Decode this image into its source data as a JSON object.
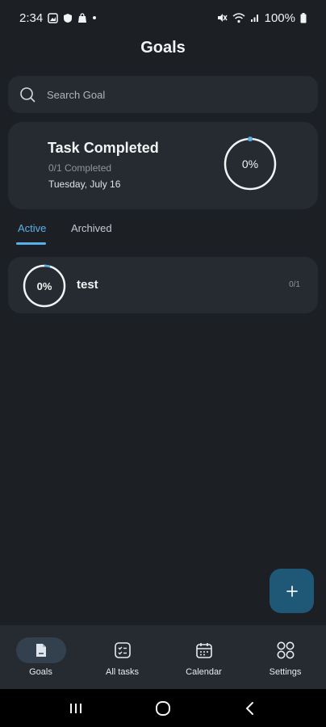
{
  "status_bar": {
    "time": "2:34",
    "battery": "100%"
  },
  "header": {
    "title": "Goals"
  },
  "search": {
    "placeholder": "Search Goal"
  },
  "summary": {
    "title": "Task Completed",
    "count": "0/1 Completed",
    "date": "Tuesday, July 16",
    "percent_label": "0%",
    "progress": 0
  },
  "tabs": [
    {
      "label": "Active",
      "selected": true
    },
    {
      "label": "Archived",
      "selected": false
    }
  ],
  "goals": [
    {
      "name": "test",
      "percent_label": "0%",
      "progress_text": "0/1",
      "progress": 0
    }
  ],
  "fab": {
    "icon": "plus-icon"
  },
  "bottom_nav": [
    {
      "label": "Goals",
      "icon": "goals-icon",
      "selected": true
    },
    {
      "label": "All tasks",
      "icon": "tasks-checklist-icon",
      "selected": false
    },
    {
      "label": "Calendar",
      "icon": "calendar-icon",
      "selected": false
    },
    {
      "label": "Settings",
      "icon": "grid-settings-icon",
      "selected": false
    }
  ],
  "colors": {
    "background": "#1c2025",
    "card": "#262b31",
    "accent": "#5ab0e8",
    "fab": "#1f5877"
  }
}
